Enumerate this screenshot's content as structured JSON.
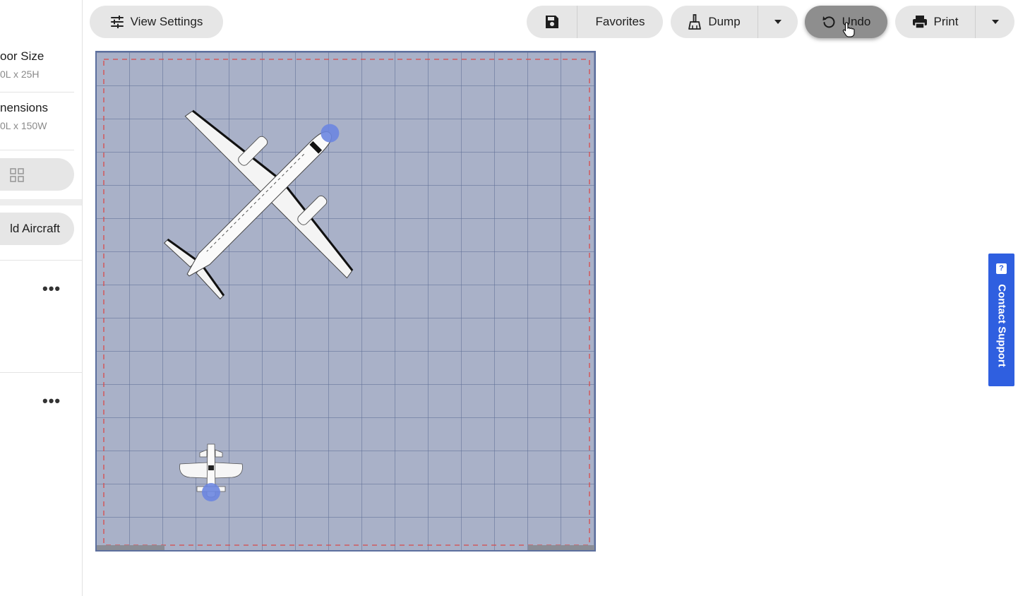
{
  "sidebar": {
    "floor_size_title": "oor Size",
    "floor_size_value": "0L x 25H",
    "dimensions_title": "nensions",
    "dimensions_value": "0L x 150W",
    "add_aircraft_label": "ld Aircraft",
    "more_label": "•••"
  },
  "toolbar": {
    "view_settings_label": "View Settings",
    "favorites_label": "Favorites",
    "dump_label": "Dump",
    "undo_label": "Undo",
    "print_label": "Print"
  },
  "support": {
    "label": "Contact Support",
    "icon_glyph": "?"
  },
  "hangar": {
    "aircraft": [
      {
        "type": "twin-turboprop",
        "heading": "northeast"
      },
      {
        "type": "single-engine",
        "heading": "south"
      }
    ]
  },
  "colors": {
    "floor": "#a9b1c8",
    "floor_border": "#5c6f9e",
    "clearance_line": "#d84a4a",
    "support_tab": "#2f5fe0",
    "prop_highlight": "#6b86e0"
  }
}
